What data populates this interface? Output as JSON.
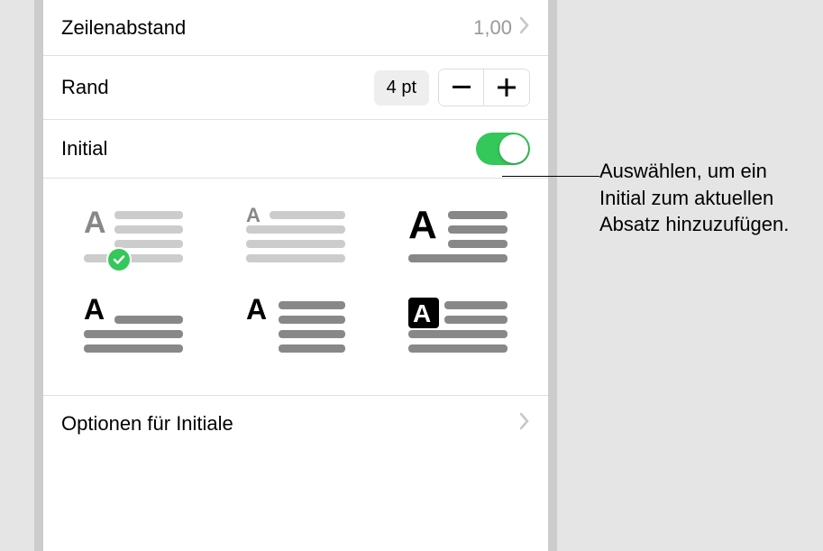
{
  "rows": {
    "line_spacing": {
      "label": "Zeilenabstand",
      "value": "1,00"
    },
    "margin": {
      "label": "Rand",
      "value": "4 pt"
    },
    "initial": {
      "label": "Initial",
      "enabled": true
    },
    "options": {
      "label": "Optionen für Initiale"
    }
  },
  "styles": [
    {
      "id": "style-1",
      "selected": true
    },
    {
      "id": "style-2",
      "selected": false
    },
    {
      "id": "style-3",
      "selected": false
    },
    {
      "id": "style-4",
      "selected": false
    },
    {
      "id": "style-5",
      "selected": false
    },
    {
      "id": "style-6",
      "selected": false
    }
  ],
  "callout": "Auswählen, um ein Initial zum aktuellen Absatz hinzuzufügen."
}
